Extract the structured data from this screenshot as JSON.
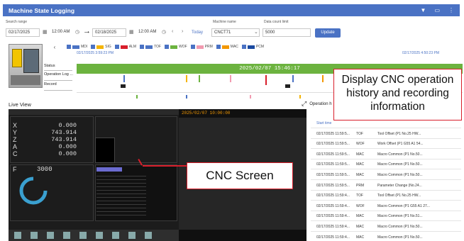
{
  "app": {
    "title": "Machine State Logging"
  },
  "toolbar": {
    "search_range_label": "Search range",
    "start_date": "02/17/2025",
    "start_time": "12:00 AM",
    "end_date": "02/18/2025",
    "end_time": "12:00 AM",
    "today_label": "Today",
    "machine_name_label": "Machine name",
    "machine_name": "CNCT71",
    "data_count_label": "Data count limit",
    "data_count": "5000",
    "update_label": "Update"
  },
  "legend": {
    "items": [
      {
        "label": "MDI",
        "color": "#4a72c4"
      },
      {
        "label": "SIG",
        "color": "#f4b400"
      },
      {
        "label": "ALM",
        "color": "#d81e2b"
      },
      {
        "label": "TOF",
        "color": "#4a72c4"
      },
      {
        "label": "WOF",
        "color": "#6cb33f"
      },
      {
        "label": "PRM",
        "color": "#f29bb0"
      },
      {
        "label": "MAC",
        "color": "#f39800"
      },
      {
        "label": "PCM",
        "color": "#1a4aa0"
      }
    ]
  },
  "timeline": {
    "start_label": "02/17/2025 3:59:23 PM",
    "end_label": "02/17/2025 4:50:23 PM",
    "rows": [
      "Status",
      "Operation Log ...",
      "Record"
    ],
    "status_text": "2025/02/07 15:46:17"
  },
  "callouts": {
    "history_line1": "Display CNC operation",
    "history_line2": "history and recording",
    "history_line3": "information",
    "cnc_screen": "CNC Screen"
  },
  "live_view": {
    "title": "Live View",
    "operation_history_label": "Operation h",
    "cnc_timestamp": "2025/02/07 10:00:00",
    "axes": [
      {
        "axis": "X",
        "value": "0.000"
      },
      {
        "axis": "Y",
        "value": "743.914"
      },
      {
        "axis": "Z",
        "value": "743.914"
      },
      {
        "axis": "A",
        "value": "0.000"
      },
      {
        "axis": "C",
        "value": "0.000"
      }
    ],
    "feed_label": "F",
    "feed_value": "3000"
  },
  "history": {
    "headers": [
      "Start time",
      "",
      ""
    ],
    "rows": [
      {
        "time": "02/17/2025 11:59:5...",
        "type": "TOF",
        "desc": "Tool Offset (P1 No.25 HW..."
      },
      {
        "time": "02/17/2025 11:59:5...",
        "type": "WOF",
        "desc": "Work Offset (P1 G55 A1 54..."
      },
      {
        "time": "02/17/2025 11:59:5...",
        "type": "MAC",
        "desc": "Macro Common (P1 No.50..."
      },
      {
        "time": "02/17/2025 11:59:5...",
        "type": "MAC",
        "desc": "Macro Common (P1 No.50..."
      },
      {
        "time": "02/17/2025 11:59:5...",
        "type": "MAC",
        "desc": "Macro Common (P1 No.50..."
      },
      {
        "time": "02/17/2025 11:59:5...",
        "type": "PRM",
        "desc": "Parameter Change (No.24..."
      },
      {
        "time": "02/17/2025 11:59:4...",
        "type": "TOF",
        "desc": "Tool Offset (P1 No.25 HW..."
      },
      {
        "time": "02/17/2025 11:59:4...",
        "type": "WOF",
        "desc": "Macro Common (P1 G55 A1 27..."
      },
      {
        "time": "02/17/2025 11:59:4...",
        "type": "MAC",
        "desc": "Macro Common (P1 No.51..."
      },
      {
        "time": "02/17/2025 11:59:4...",
        "type": "MAC",
        "desc": "Macro Common (P1 No.50..."
      },
      {
        "time": "02/17/2025 11:59:4...",
        "type": "MAC",
        "desc": "Macro Common (P1 No.50..."
      }
    ]
  }
}
